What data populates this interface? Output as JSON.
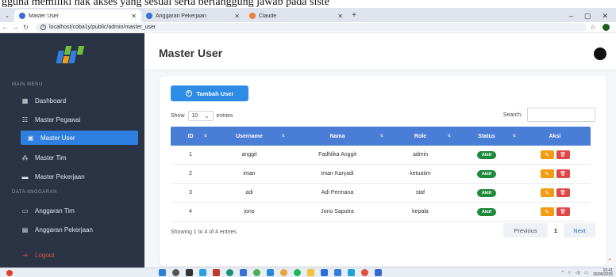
{
  "caption": "gguna memiliki hak akses yang sesuai serta bertanggung jawab pada siste",
  "browser": {
    "tabs": [
      {
        "title": "Master User",
        "active": true
      },
      {
        "title": "Anggaran Pekerjaan",
        "active": false
      },
      {
        "title": "Claude",
        "active": false
      }
    ],
    "url": "localhost/coba1y/public/admin/master_user",
    "window_controls": [
      "–",
      "▢",
      "✕"
    ]
  },
  "sidebar": {
    "section_main": "MAIN MENU",
    "items_main": [
      {
        "label": "Dashboard",
        "icon": "dashboard-icon",
        "active": false
      },
      {
        "label": "Master Pegawai",
        "icon": "users-icon",
        "active": false
      },
      {
        "label": "Master User",
        "icon": "user-card-icon",
        "active": true
      },
      {
        "label": "Master Tim",
        "icon": "team-icon",
        "active": false
      },
      {
        "label": "Master Pekerjaan",
        "icon": "briefcase-icon",
        "active": false
      }
    ],
    "section_budget": "DATA ANGGARAN",
    "items_budget": [
      {
        "label": "Anggaran Tim",
        "icon": "money-icon"
      },
      {
        "label": "Anggaran Pekerjaan",
        "icon": "calculator-icon"
      }
    ],
    "logout": "Logout"
  },
  "header": {
    "title": "Master User"
  },
  "content": {
    "add_button": "Tambah User",
    "show_label": "Show",
    "entries_value": "10",
    "entries_label": "entries",
    "search_label": "Search:",
    "search_value": "",
    "columns": [
      "ID",
      "Username",
      "Nama",
      "Role",
      "Status",
      "Aksi"
    ],
    "rows": [
      {
        "id": "1",
        "username": "anggit",
        "nama": "Fadhlika Anggit",
        "role": "admin",
        "status": "Aktif"
      },
      {
        "id": "2",
        "username": "iman",
        "nama": "Iman Karyadi",
        "role": "ketuatim",
        "status": "Aktif"
      },
      {
        "id": "3",
        "username": "adi",
        "nama": "Adi Permana",
        "role": "staf",
        "status": "Aktif"
      },
      {
        "id": "4",
        "username": "jono",
        "nama": "Jono Saputra",
        "role": "kepala",
        "status": "Aktif"
      }
    ],
    "info": "Showing 1 to 4 of 4 entries",
    "pagination": {
      "prev": "Previous",
      "current": "1",
      "next": "Next"
    }
  },
  "taskbar": {
    "time": "10.41",
    "date": "26/05/2025"
  },
  "colors": {
    "sidebar": "#2b3445",
    "accent": "#2f7fe0",
    "table_header": "#4a7dd6",
    "badge": "#1e8a3c",
    "edit": "#f39c12",
    "delete": "#e04848"
  }
}
